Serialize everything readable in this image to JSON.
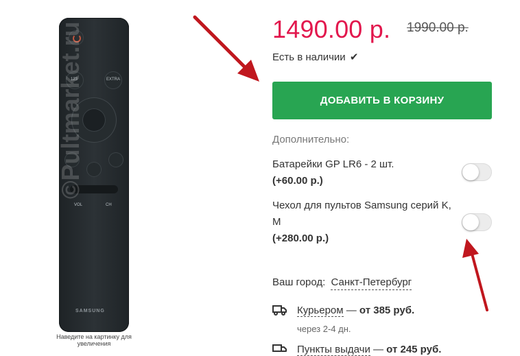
{
  "product": {
    "remote_labels": {
      "num": "123",
      "extra": "EXTRA",
      "vol": "VOL",
      "ch": "CH",
      "brand": "SAMSUNG"
    },
    "watermark": "©Pultmarket.ru",
    "image_caption": "Наведите на картинку для увеличения"
  },
  "pricing": {
    "price": "1490.00 р.",
    "old_price": "1990.00 р.",
    "stock_text": "Есть в наличии",
    "stock_icon": "check-icon"
  },
  "cart": {
    "add_button": "ДОБАВИТЬ В КОРЗИНУ",
    "button_color": "#28a552"
  },
  "extras": {
    "title": "Дополнительно:",
    "options": [
      {
        "name": "Батарейки GP LR6 - 2 шт.",
        "price": "(+60.00 р.)",
        "enabled": false
      },
      {
        "name": "Чехол для пультов Samsung серий K, M",
        "price": "(+280.00 р.)",
        "enabled": false
      }
    ]
  },
  "delivery": {
    "city_label": "Ваш город:",
    "city": "Санкт-Петербург",
    "courier_link": "Курьером",
    "courier_dash": " — ",
    "courier_price": "от 385 руб.",
    "courier_time": "через 2-4 дн.",
    "pickup_link": "Пункты выдачи",
    "pickup_dash": " — ",
    "pickup_price": "от 245 руб."
  },
  "colors": {
    "price": "#e2174d",
    "arrow": "#c0171e"
  }
}
